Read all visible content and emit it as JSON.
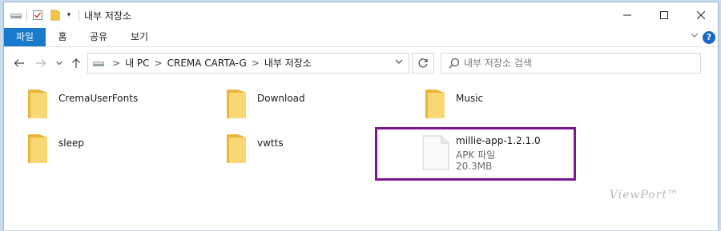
{
  "window": {
    "title": "내부 저장소",
    "minimize_icon": "minimize-icon",
    "maximize_icon": "maximize-icon",
    "close_icon": "close-icon"
  },
  "ribbon": {
    "tabs": [
      {
        "label": "파일",
        "active": true
      },
      {
        "label": "홈",
        "active": false
      },
      {
        "label": "공유",
        "active": false
      },
      {
        "label": "보기",
        "active": false
      }
    ],
    "help_label": "?",
    "accent_color": "#1979ca"
  },
  "address_bar": {
    "breadcrumbs": [
      "내 PC",
      "CREMA CARTA-G",
      "내부 저장소"
    ]
  },
  "search": {
    "placeholder": "내부 저장소 검색"
  },
  "items": [
    {
      "name": "CremaUserFonts",
      "type": "folder"
    },
    {
      "name": "Download",
      "type": "folder"
    },
    {
      "name": "Music",
      "type": "folder"
    },
    {
      "name": "sleep",
      "type": "folder"
    },
    {
      "name": "vwtts",
      "type": "folder"
    },
    {
      "name": "millie-app-1.2.1.0",
      "type": "file",
      "kind": "APK 파일",
      "size": "20.3MB",
      "highlighted": true
    }
  ],
  "highlight_color": "#7b1591",
  "watermark": "ViewPort™"
}
